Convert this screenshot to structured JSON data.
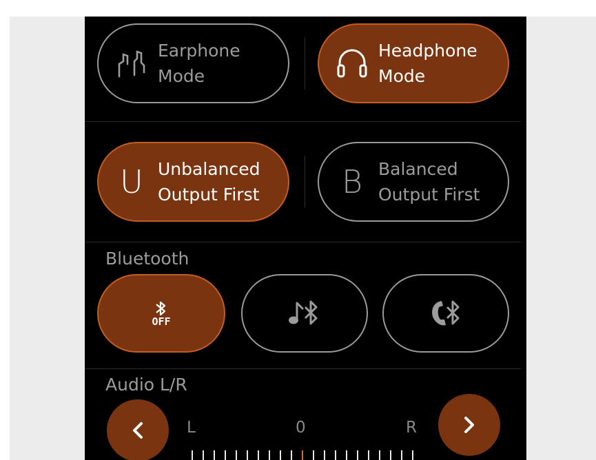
{
  "theme": {
    "accent_fill": "#7a3410",
    "accent_border": "#c45c26",
    "inactive_border": "#9a9a9a",
    "inactive_text": "#9c9c9c",
    "panel_bg": "#000000",
    "center_tick": "#e06a2a"
  },
  "output_mode": {
    "earphone": {
      "label": "Earphone\nMode",
      "icon": "earphone-icon",
      "active": false
    },
    "headphone": {
      "label": "Headphone\nMode",
      "icon": "headphone-icon",
      "active": true
    }
  },
  "output_priority": {
    "unbalanced": {
      "label": "Unbalanced\nOutput First",
      "icon_glyph": "U",
      "active": true
    },
    "balanced": {
      "label": "Balanced\nOutput First",
      "icon_glyph": "B",
      "active": false
    }
  },
  "bluetooth": {
    "title": "Bluetooth",
    "options": [
      {
        "icon": "bluetooth-off-icon",
        "badge": "OFF",
        "active": true
      },
      {
        "icon": "bluetooth-music-icon",
        "active": false
      },
      {
        "icon": "bluetooth-call-icon",
        "active": false
      }
    ]
  },
  "audio_balance": {
    "title": "Audio L/R",
    "left_label": "L",
    "center_label": "0",
    "right_label": "R",
    "value": 0,
    "prev_icon": "chevron-left-icon",
    "next_icon": "chevron-right-icon"
  }
}
